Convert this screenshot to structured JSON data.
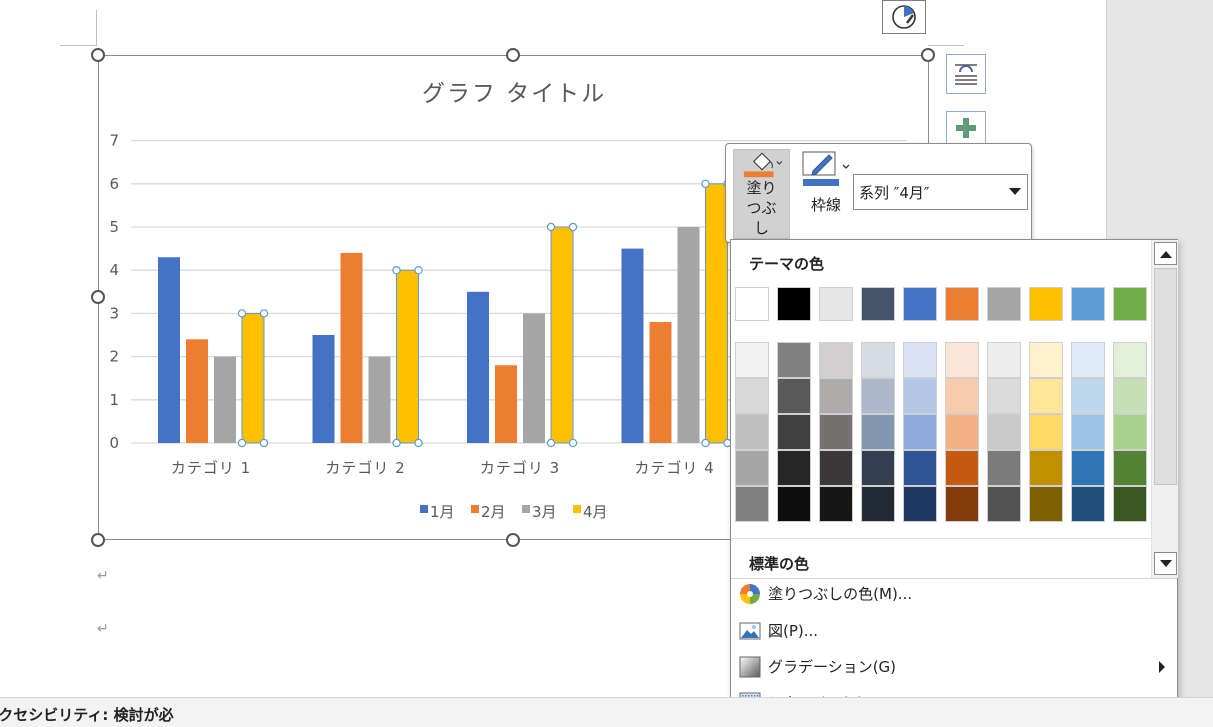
{
  "chart_data": {
    "type": "bar",
    "title": "グラフ タイトル",
    "categories": [
      "カテゴリ 1",
      "カテゴリ 2",
      "カテゴリ 3",
      "カテゴリ 4"
    ],
    "series": [
      {
        "name": "1月",
        "color": "#4472c4",
        "values": [
          4.3,
          2.5,
          3.5,
          4.5
        ]
      },
      {
        "name": "2月",
        "color": "#ed7d31",
        "values": [
          2.4,
          4.4,
          1.8,
          2.8
        ]
      },
      {
        "name": "3月",
        "color": "#a5a5a5",
        "values": [
          2,
          2,
          3,
          5
        ]
      },
      {
        "name": "4月",
        "color": "#ffc000",
        "values": [
          3,
          4,
          5,
          6
        ]
      }
    ],
    "selected_series": "4月",
    "ylim": [
      0,
      7
    ],
    "yticks": [
      "0",
      "1",
      "2",
      "3",
      "4",
      "5",
      "6",
      "7"
    ],
    "grid": true,
    "legend_position": "bottom"
  },
  "mini_toolbar": {
    "fill_label": "塗りつぶし",
    "outline_label": "枠線",
    "series_value": "系列 ″4月″",
    "fill_icon_color": "#ed7d31",
    "outline_icon_color": "#4472c4"
  },
  "palette": {
    "theme_heading": "テーマの色",
    "standard_heading": "標準の色",
    "theme_colors": [
      "#ffffff",
      "#000000",
      "#e7e6e6",
      "#44546a",
      "#4472c4",
      "#ed7d31",
      "#a5a5a5",
      "#ffc000",
      "#5b9bd5",
      "#70ad47"
    ],
    "shades": [
      [
        "#f2f2f2",
        "#d9d9d9",
        "#bfbfbf",
        "#a6a6a6",
        "#808080"
      ],
      [
        "#808080",
        "#595959",
        "#404040",
        "#262626",
        "#0d0d0d"
      ],
      [
        "#d0cece",
        "#aeabab",
        "#757171",
        "#3a3838",
        "#171616"
      ],
      [
        "#d6dce5",
        "#adb9ca",
        "#8497b0",
        "#333f50",
        "#222a35"
      ],
      [
        "#dae3f3",
        "#b4c7e7",
        "#8faadc",
        "#2f5597",
        "#1f3864"
      ],
      [
        "#fbe5d6",
        "#f8cbad",
        "#f4b183",
        "#c55a11",
        "#843c0c"
      ],
      [
        "#ededed",
        "#dbdbdb",
        "#c9c9c9",
        "#7b7b7b",
        "#525252"
      ],
      [
        "#fff2cc",
        "#ffe699",
        "#ffd966",
        "#bf9000",
        "#7f6000"
      ],
      [
        "#deebf7",
        "#bdd7ee",
        "#9dc3e6",
        "#2e75b6",
        "#1f4e79"
      ],
      [
        "#e2f0d9",
        "#c5e0b4",
        "#a9d18e",
        "#548235",
        "#385723"
      ]
    ]
  },
  "menu": {
    "more_colors": "塗りつぶしの色(M)...",
    "picture": "図(P)...",
    "gradient": "グラデーション(G)",
    "texture": "テクスチャ(T)"
  },
  "status": {
    "accessibility": "アクセシビリティ: 検討が必"
  }
}
